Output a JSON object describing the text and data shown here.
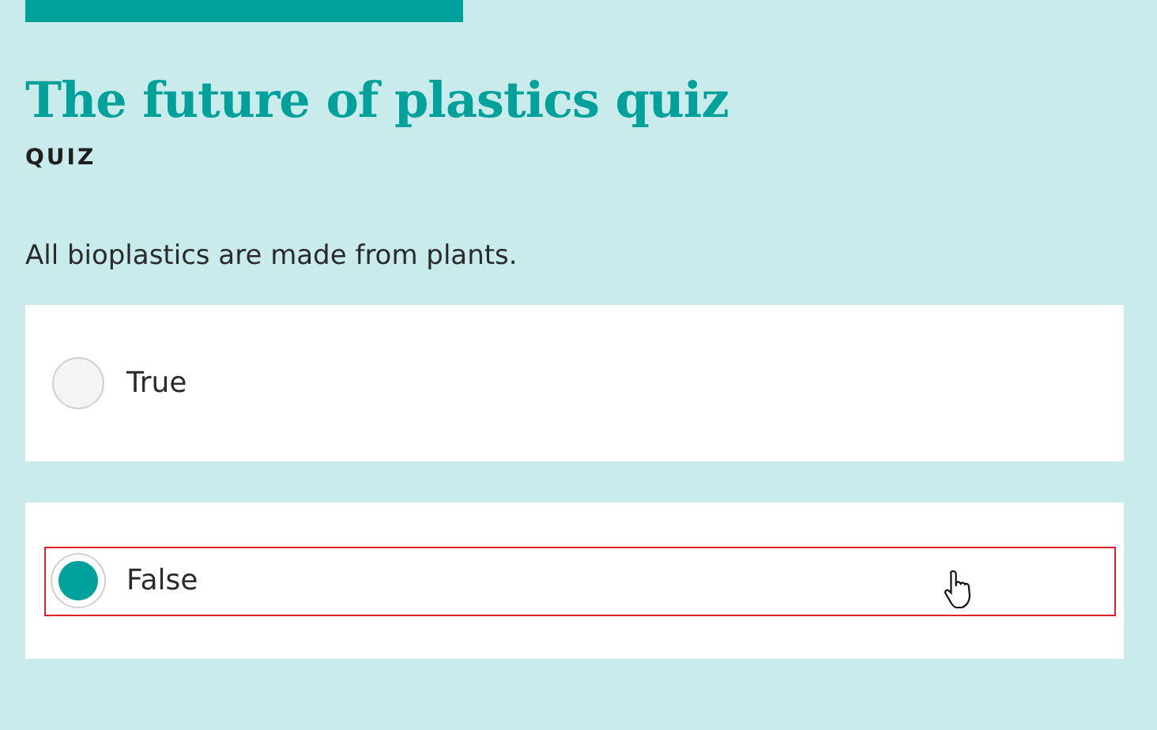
{
  "quiz": {
    "title": "The future of plastics quiz",
    "type_label": "QUIZ",
    "question": "All bioplastics are made from plants."
  },
  "options": [
    {
      "label": "True",
      "selected": false,
      "focused": false
    },
    {
      "label": "False",
      "selected": true,
      "focused": true
    }
  ]
}
